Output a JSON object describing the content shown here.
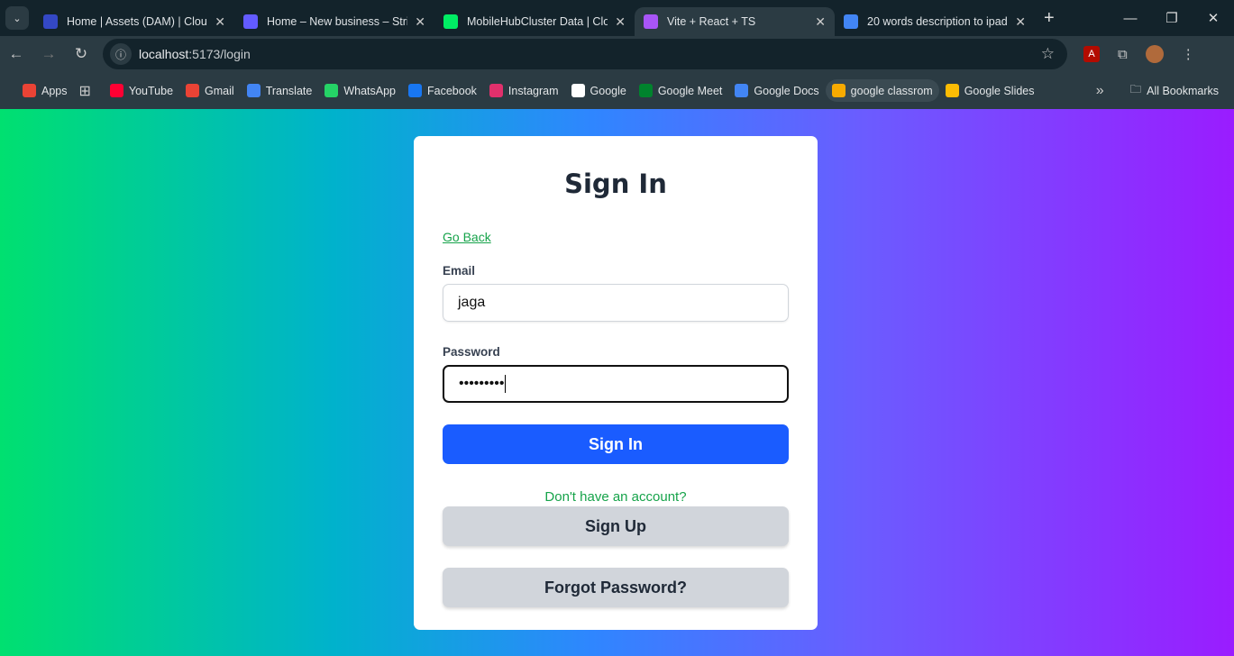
{
  "browser": {
    "tabs": [
      {
        "title": "Home | Assets (DAM) | Cloudinary",
        "color": "#3448c5"
      },
      {
        "title": "Home – New business – Stripe",
        "color": "#635bff"
      },
      {
        "title": "MobileHubCluster Data | Cloud",
        "color": "#00ed64"
      },
      {
        "title": "Vite + React + TS",
        "color": "#a855f7",
        "active": true
      },
      {
        "title": "20 words description to ipad",
        "color": "#4285f4"
      }
    ],
    "url_host": "localhost",
    "url_path": ":5173/login",
    "bookmarks": [
      {
        "label": "Apps",
        "color": "#ea4335"
      },
      {
        "label": "YouTube",
        "color": "#ff0033"
      },
      {
        "label": "Gmail",
        "color": "#ea4335"
      },
      {
        "label": "Translate",
        "color": "#4285f4"
      },
      {
        "label": "WhatsApp",
        "color": "#25d366"
      },
      {
        "label": "Facebook",
        "color": "#1877f2"
      },
      {
        "label": "Instagram",
        "color": "#e1306c"
      },
      {
        "label": "Google",
        "color": "#ffffff"
      },
      {
        "label": "Google Meet",
        "color": "#00832d"
      },
      {
        "label": "Google Docs",
        "color": "#4285f4"
      },
      {
        "label": "google classrom",
        "color": "#f9ab00"
      },
      {
        "label": "Google Slides",
        "color": "#fbbc04"
      }
    ],
    "all_bookmarks": "All Bookmarks"
  },
  "form": {
    "title": "Sign In",
    "go_back": "Go Back",
    "email_label": "Email",
    "email_value": "jaga",
    "password_label": "Password",
    "password_value": "•••••••••",
    "submit": "Sign In",
    "no_account": "Don't have an account?",
    "sign_up": "Sign Up",
    "forgot": "Forgot Password?"
  }
}
